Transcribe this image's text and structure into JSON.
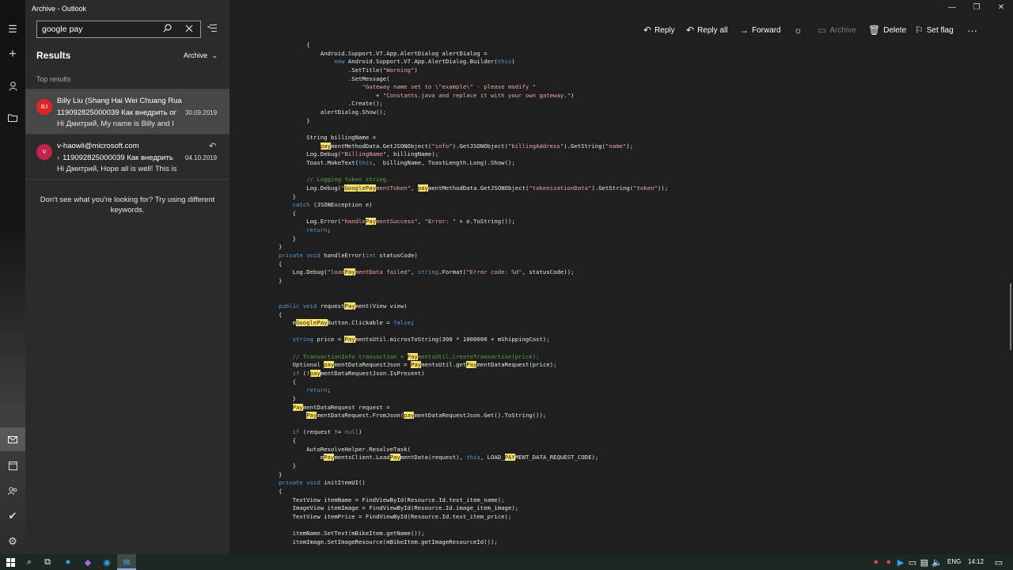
{
  "window": {
    "title": "Archive - Outlook",
    "controls": [
      "—",
      "❐",
      "✕"
    ]
  },
  "search": {
    "query": "google pay",
    "search_icon": "search-icon",
    "clear_icon": "close-icon"
  },
  "results": {
    "heading": "Results",
    "folder": "Archive",
    "section": "Top results",
    "items": [
      {
        "initials": "BJ",
        "from": "Billy Liu (Shang Hai Wei Chuang Ruan",
        "subject": "119092825000039 Как внедрить ог",
        "date": "30.09.2019",
        "preview": "Hi Дмитрий, My name is Billy and I",
        "selected": true,
        "avatar_color": "#e02525"
      },
      {
        "initials": "V",
        "from": "v-haowli@microsoft.com",
        "subject": "119092825000039 Как внедрить",
        "date": "04.10.2019",
        "preview": "Hi Дмитрий, Hope all is well! This is",
        "selected": false,
        "replied": true,
        "avatar_color": "#c0254d"
      }
    ],
    "hint": "Don't see what you're looking for?  Try using different keywords."
  },
  "toolbar": {
    "reply": "Reply",
    "reply_all": "Reply all",
    "forward": "Forward",
    "archive": "Archive",
    "delete": "Delete",
    "set_flag": "Set flag",
    "more": "···"
  },
  "code_lines": [
    [
      [
        "t",
        "        {"
      ]
    ],
    [
      [
        "t",
        "            Android.Support.V7.App.AlertDialog alertDialog ="
      ]
    ],
    [
      [
        "t",
        "                "
      ],
      [
        "kw",
        "new"
      ],
      [
        "t",
        " Android.Support.V7.App.AlertDialog.Builder("
      ],
      [
        "kw",
        "this"
      ],
      [
        "t",
        ")"
      ]
    ],
    [
      [
        "t",
        "                    .SetTitle("
      ],
      [
        "str",
        "\"Warning\""
      ],
      [
        "t",
        ")"
      ]
    ],
    [
      [
        "t",
        "                    .SetMessage("
      ]
    ],
    [
      [
        "t",
        "                        "
      ],
      [
        "str",
        "\"Gateway name set to \\\"example\\\" - please modify \""
      ]
    ],
    [
      [
        "t",
        "                            + "
      ],
      [
        "str",
        "\"Constants.java and replace it with your own gateway.\""
      ],
      [
        "t",
        ")"
      ]
    ],
    [
      [
        "t",
        "                    .Create();"
      ]
    ],
    [
      [
        "t",
        "            alertDialog.Show();"
      ]
    ],
    [
      [
        "t",
        "        }"
      ]
    ],
    [
      [
        "t",
        ""
      ]
    ],
    [
      [
        "t",
        "        String billingName ="
      ]
    ],
    [
      [
        "t",
        "            "
      ],
      [
        "hl",
        "pay"
      ],
      [
        "t",
        "mentMethodData.GetJSONObject("
      ],
      [
        "str",
        "\"info\""
      ],
      [
        "t",
        ").GetJSONObject("
      ],
      [
        "str",
        "\"billingAddress\""
      ],
      [
        "t",
        ").GetString("
      ],
      [
        "str",
        "\"name\""
      ],
      [
        "t",
        ");"
      ]
    ],
    [
      [
        "t",
        "        Log.Debug("
      ],
      [
        "str",
        "\"BillingName\""
      ],
      [
        "t",
        ", billingName);"
      ]
    ],
    [
      [
        "t",
        "        Toast.MakeText("
      ],
      [
        "kw",
        "this"
      ],
      [
        "t",
        ",  billingName, ToastLength.Long).Show();"
      ]
    ],
    [
      [
        "t",
        ""
      ]
    ],
    [
      [
        "t",
        "        "
      ],
      [
        "cm",
        "// Logging token string."
      ]
    ],
    [
      [
        "t",
        "        Log.Debug("
      ],
      [
        "str",
        "\""
      ],
      [
        "hl",
        "GooglePay"
      ],
      [
        "str",
        "mentToken\""
      ],
      [
        "t",
        ", "
      ],
      [
        "hl",
        "pay"
      ],
      [
        "t",
        "mentMethodData.GetJSONObject("
      ],
      [
        "str",
        "\"tokenizationData\""
      ],
      [
        "t",
        ").GetString("
      ],
      [
        "str",
        "\"token\""
      ],
      [
        "t",
        "));"
      ]
    ],
    [
      [
        "t",
        "    }"
      ]
    ],
    [
      [
        "t",
        "    "
      ],
      [
        "kw",
        "catch"
      ],
      [
        "t",
        " (JSONException e)"
      ]
    ],
    [
      [
        "t",
        "    {"
      ]
    ],
    [
      [
        "t",
        "        Log.Error("
      ],
      [
        "str",
        "\"handle"
      ],
      [
        "hl",
        "Pay"
      ],
      [
        "str",
        "mentSuccess\""
      ],
      [
        "t",
        ", "
      ],
      [
        "str",
        "\"Error: \""
      ],
      [
        "t",
        " + e.ToString());"
      ]
    ],
    [
      [
        "t",
        "        "
      ],
      [
        "kw",
        "return"
      ],
      [
        "t",
        ";"
      ]
    ],
    [
      [
        "t",
        "    }"
      ]
    ],
    [
      [
        "t",
        "}"
      ]
    ],
    [
      [
        "kw",
        "private void"
      ],
      [
        "t",
        " handleError("
      ],
      [
        "kw",
        "int"
      ],
      [
        "t",
        " statusCode)"
      ]
    ],
    [
      [
        "t",
        "{"
      ]
    ],
    [
      [
        "t",
        "    Log.Debug("
      ],
      [
        "str",
        "\"load"
      ],
      [
        "hl",
        "Pay"
      ],
      [
        "str",
        "mentData failed\""
      ],
      [
        "t",
        ", "
      ],
      [
        "kw",
        "string"
      ],
      [
        "t",
        ".Format("
      ],
      [
        "str",
        "\"Error code: %d\""
      ],
      [
        "t",
        ", statusCode));"
      ]
    ],
    [
      [
        "t",
        "}"
      ]
    ],
    [
      [
        "t",
        ""
      ]
    ],
    [
      [
        "t",
        ""
      ]
    ],
    [
      [
        "kw",
        "public void"
      ],
      [
        "t",
        " request"
      ],
      [
        "hl",
        "Pay"
      ],
      [
        "t",
        "ment(View view)"
      ]
    ],
    [
      [
        "t",
        "{"
      ]
    ],
    [
      [
        "t",
        "    m"
      ],
      [
        "hl",
        "GooglePay"
      ],
      [
        "t",
        "Button.Clickable = "
      ],
      [
        "kw",
        "false"
      ],
      [
        "t",
        ";"
      ]
    ],
    [
      [
        "t",
        ""
      ]
    ],
    [
      [
        "t",
        "    "
      ],
      [
        "kw",
        "string"
      ],
      [
        "t",
        " price = "
      ],
      [
        "hl",
        "Pay"
      ],
      [
        "t",
        "mentsUtil.microsToString(300 * 1000000 + mShippingCost);"
      ]
    ],
    [
      [
        "t",
        ""
      ]
    ],
    [
      [
        "t",
        "    "
      ],
      [
        "cm",
        "// TransactionInfo transaction = "
      ],
      [
        "hl",
        "Pay"
      ],
      [
        "cm",
        "mentsUtil.createTransaction(price);"
      ]
    ],
    [
      [
        "t",
        "    Optional "
      ],
      [
        "hl",
        "pay"
      ],
      [
        "t",
        "mentDataRequestJson = "
      ],
      [
        "hl",
        "Pay"
      ],
      [
        "t",
        "mentsUtil.get"
      ],
      [
        "hl",
        "Pay"
      ],
      [
        "t",
        "mentDataRequest(price);"
      ]
    ],
    [
      [
        "t",
        "    "
      ],
      [
        "kw",
        "if"
      ],
      [
        "t",
        " (!"
      ],
      [
        "hl",
        "pay"
      ],
      [
        "t",
        "mentDataRequestJson.IsPresent)"
      ]
    ],
    [
      [
        "t",
        "    {"
      ]
    ],
    [
      [
        "t",
        "        "
      ],
      [
        "kw",
        "return"
      ],
      [
        "t",
        ";"
      ]
    ],
    [
      [
        "t",
        "    }"
      ]
    ],
    [
      [
        "t",
        "    "
      ],
      [
        "hl",
        "Pay"
      ],
      [
        "t",
        "mentDataRequest request ="
      ]
    ],
    [
      [
        "t",
        "        "
      ],
      [
        "hl",
        "Pay"
      ],
      [
        "t",
        "mentDataRequest.FromJson("
      ],
      [
        "hl",
        "pay"
      ],
      [
        "t",
        "mentDataRequestJson.Get().ToString());"
      ]
    ],
    [
      [
        "t",
        ""
      ]
    ],
    [
      [
        "t",
        "    "
      ],
      [
        "kw",
        "if"
      ],
      [
        "t",
        " (request != "
      ],
      [
        "kw",
        "null"
      ],
      [
        "t",
        ")"
      ]
    ],
    [
      [
        "t",
        "    {"
      ]
    ],
    [
      [
        "t",
        "        AutoResolveHelper.ResolveTask("
      ]
    ],
    [
      [
        "t",
        "            m"
      ],
      [
        "hl",
        "Pay"
      ],
      [
        "t",
        "mentsClient.Load"
      ],
      [
        "hl",
        "Pay"
      ],
      [
        "t",
        "mentData(request), "
      ],
      [
        "kw",
        "this"
      ],
      [
        "t",
        ", LOAD_"
      ],
      [
        "hl",
        "PAY"
      ],
      [
        "t",
        "MENT_DATA_REQUEST_CODE);"
      ]
    ],
    [
      [
        "t",
        "    }"
      ]
    ],
    [
      [
        "t",
        "}"
      ]
    ],
    [
      [
        "kw",
        "private void"
      ],
      [
        "t",
        " initItemUI()"
      ]
    ],
    [
      [
        "t",
        "{"
      ]
    ],
    [
      [
        "t",
        "    TextView itemName = FindViewById(Resource.Id.text_item_name);"
      ]
    ],
    [
      [
        "t",
        "    ImageView itemImage = FindViewById(Resource.Id.image_item_image);"
      ]
    ],
    [
      [
        "t",
        "    TextView itemPrice = FindViewById(Resource.Id.text_item_price);"
      ]
    ],
    [
      [
        "t",
        ""
      ]
    ],
    [
      [
        "t",
        "    itemName.SetText(mBikeItem.getName());"
      ]
    ],
    [
      [
        "t",
        "    itemImage.SetImageResource(mBikeItem.getImageResourceId());"
      ]
    ]
  ],
  "taskbar": {
    "language": "ENG",
    "time": "14:12"
  }
}
